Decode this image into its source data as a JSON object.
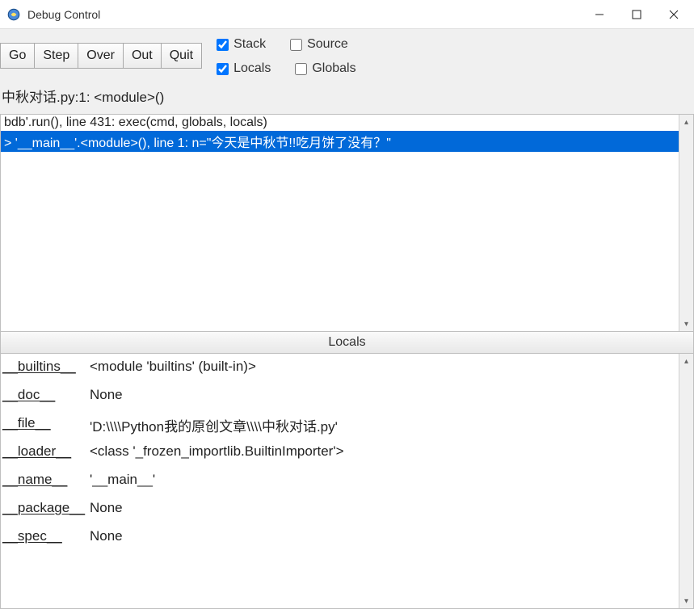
{
  "window": {
    "title": "Debug Control"
  },
  "toolbar": {
    "go": "Go",
    "step": "Step",
    "over": "Over",
    "out": "Out",
    "quit": "Quit"
  },
  "checks": {
    "stack": {
      "label": "Stack",
      "checked": true
    },
    "source": {
      "label": "Source",
      "checked": false
    },
    "locals": {
      "label": "Locals",
      "checked": true
    },
    "globals": {
      "label": "Globals",
      "checked": false
    }
  },
  "status_line": "中秋对话.py:1: <module>()",
  "stack": {
    "lines": [
      {
        "text": "bdb'.run(), line 431: exec(cmd, globals, locals)",
        "selected": false
      },
      {
        "text": "> '__main__'.<module>(), line 1: n=\"今天是中秋节!!吃月饼了没有？\"",
        "selected": true
      }
    ]
  },
  "locals_header": "Locals",
  "locals": [
    {
      "key": "__builtins__",
      "value": "<module 'builtins' (built-in)>"
    },
    {
      "key": "__doc__",
      "value": "None"
    },
    {
      "key": "__file__",
      "value": "'D:\\\\\\\\Python我的原创文章\\\\\\\\中秋对话.py'"
    },
    {
      "key": "__loader__",
      "value": "<class '_frozen_importlib.BuiltinImporter'>"
    },
    {
      "key": "__name__",
      "value": "'__main__'"
    },
    {
      "key": "__package__",
      "value": "None"
    },
    {
      "key": "__spec__",
      "value": "None"
    }
  ]
}
